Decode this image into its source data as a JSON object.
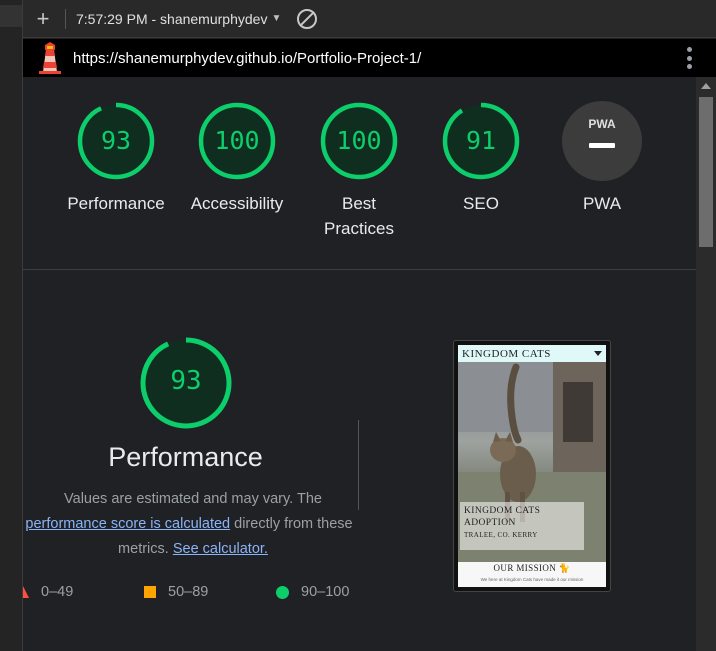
{
  "toolbar": {
    "add_label": "+",
    "report_label": "7:57:29 PM - shanemurphydev"
  },
  "urlbar": {
    "url": "https://shanemurphydev.github.io/Portfolio-Project-1/"
  },
  "gauges": [
    {
      "score": "93",
      "label": "Performance"
    },
    {
      "score": "100",
      "label": "Accessibility"
    },
    {
      "score": "100",
      "label_line1": "Best",
      "label_line2": "Practices"
    },
    {
      "score": "91",
      "label": "SEO"
    },
    {
      "badge": "PWA",
      "label": "PWA"
    }
  ],
  "performance": {
    "score": "93",
    "title": "Performance",
    "desc_prefix": "Values are estimated and may vary. The",
    "desc_link1": "performance score is calculated",
    "desc_mid": "directly from these",
    "desc_line3_prefix": "metrics.",
    "desc_link2": "See calculator."
  },
  "legend": {
    "fail": "0–49",
    "average": "50–89",
    "pass": "90–100"
  },
  "thumbnail": {
    "header": "KINGDOM CATS",
    "caption_line1": "KINGDOM CATS",
    "caption_line2": "ADOPTION",
    "caption_line3": "TRALEE, CO. KERRY",
    "footer_title": "OUR MISSION",
    "footer_text": "We here at Kingdom Cats have made it our mission"
  },
  "colors": {
    "pass": "#0cce6b",
    "average": "#ffa400",
    "fail": "#ff4e42",
    "link": "#8ab4f8"
  }
}
